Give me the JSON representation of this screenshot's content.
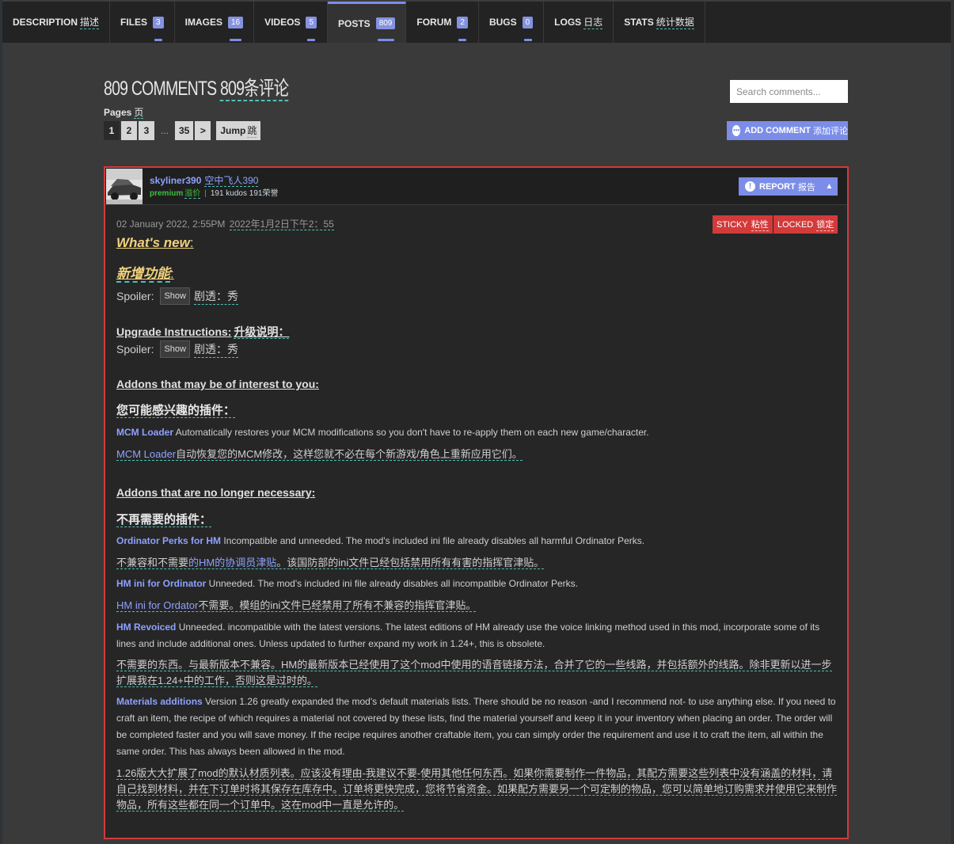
{
  "tabs": [
    {
      "label": "DESCRIPTION",
      "cn": "描述",
      "badge": null,
      "active": false
    },
    {
      "label": "FILES",
      "cn": "",
      "badge": "3",
      "active": false
    },
    {
      "label": "IMAGES",
      "cn": "",
      "badge": "16",
      "active": false
    },
    {
      "label": "VIDEOS",
      "cn": "",
      "badge": "5",
      "active": false
    },
    {
      "label": "POSTS",
      "cn": "",
      "badge": "809",
      "active": true
    },
    {
      "label": "FORUM",
      "cn": "",
      "badge": "2",
      "active": false
    },
    {
      "label": "BUGS",
      "cn": "",
      "badge": "0",
      "active": false
    },
    {
      "label": "LOGS",
      "cn": "日志",
      "badge": null,
      "active": false
    },
    {
      "label": "STATS",
      "cn": "统计数据",
      "badge": null,
      "active": false
    }
  ],
  "header": {
    "title": "809 COMMENTS",
    "title_cn": "809条评论",
    "search_placeholder": "Search comments...",
    "pages_label": "Pages",
    "pages_label_cn": "页",
    "pages": [
      "1",
      "2",
      "3",
      "...",
      "35"
    ],
    "current_page": "1",
    "next_symbol": ">",
    "jump_label": "Jump",
    "jump_cn": "跳",
    "add_comment": "ADD COMMENT",
    "add_comment_cn": "添加评论"
  },
  "comment": {
    "username": "skyliner390",
    "username_cn": "空中飞人390",
    "role": "premium",
    "role_cn": "溢价",
    "separator": "|",
    "kudos": "191 kudos",
    "kudos_cn": "191荣誉",
    "report": "REPORT",
    "report_cn": "报告",
    "collapse_symbol": "▲",
    "date": "02 January 2022, 2:55PM",
    "date_cn": "2022年1月2日下午2：55",
    "sticky": "STICKY",
    "sticky_cn": "粘性",
    "locked": "LOCKED",
    "locked_cn": "锁定",
    "whats_new": "What's new",
    "whats_new_cn": "新增功能",
    "colon": ":",
    "spoiler_label": "Spoiler:",
    "spoiler_btn": "Show",
    "spoiler_cn": "剧透：秀",
    "upgrade": "Upgrade Instructions:",
    "upgrade_cn": "升级说明：",
    "addons_interest": "Addons that may be of interest to you:",
    "addons_interest_cn": "您可能感兴趣的插件：",
    "mcm_link": "MCM Loader",
    "mcm_text": " Automatically restores your MCM modifications so you don't have to re-apply them on each new game/character.",
    "mcm_cn": "自动恢复您的MCM修改，这样您就不必在每个新游戏/角色上重新应用它们。",
    "addons_no": "Addons that are no longer necessary:",
    "addons_no_cn": "不再需要的插件：",
    "ord_link": "Ordinator Perks for HM",
    "ord_text": " Incompatible and unneeded. The mod's included ini file already disables all harmful Ordinator Perks.",
    "ord_cn_a": "不兼容和不需要",
    "ord_cn_link": "的HM的协调员津贴",
    "ord_cn_b": "。该国防部的ini文件已经包括禁用所有有害的指挥官津贴。",
    "hmini_link": "HM ini for Ordinator",
    "hmini_text": " Unneeded. The mod's included ini file already disables all incompatible Ordinator Perks.",
    "hmini_cn_link": "HM ini for Ordator",
    "hmini_cn": "不需要。模组的ini文件已经禁用了所有不兼容的指挥官津贴。",
    "revoiced_link": "HM Revoiced",
    "revoiced_text": " Unneeded. incompatible with the latest versions. The latest editions of HM already use the voice linking method used in this mod, incorporate some of its lines and include additional ones. Unless updated to further expand my work in 1.24+, this is obsolete.",
    "revoiced_cn": "不需要的东西。与最新版本不兼容。HM的最新版本已经使用了这个mod中使用的语音链接方法，合并了它的一些线路，并包括额外的线路。除非更新以进一步扩展我在1.24+中的工作，否则这是过时的。",
    "materials_link": "Materials additions",
    "materials_text": " Version 1.26 greatly expanded the mod's default materials lists. There should be no reason -and I recommend not- to use anything else. If you need to craft an item, the recipe of which requires a material not covered by these lists, find the material yourself and keep it in your inventory when placing an order. The order will be completed faster and you will save money. If the recipe requires another craftable item, you can simply order the requirement and use it to craft the item, all within the same order. This has always been allowed in the mod.",
    "materials_cn": "1.26版大大扩展了mod的默认材质列表。应该没有理由-我建议不要-使用其他任何东西。如果你需要制作一件物品，其配方需要这些列表中没有涵盖的材料，请自己找到材料，并在下订单时将其保存在库存中。订单将更快完成，您将节省资金。如果配方需要另一个可定制的物品，您可以简单地订购需求并使用它来制作物品，所有这些都在同一个订单中。这在mod中一直是允许的。"
  }
}
